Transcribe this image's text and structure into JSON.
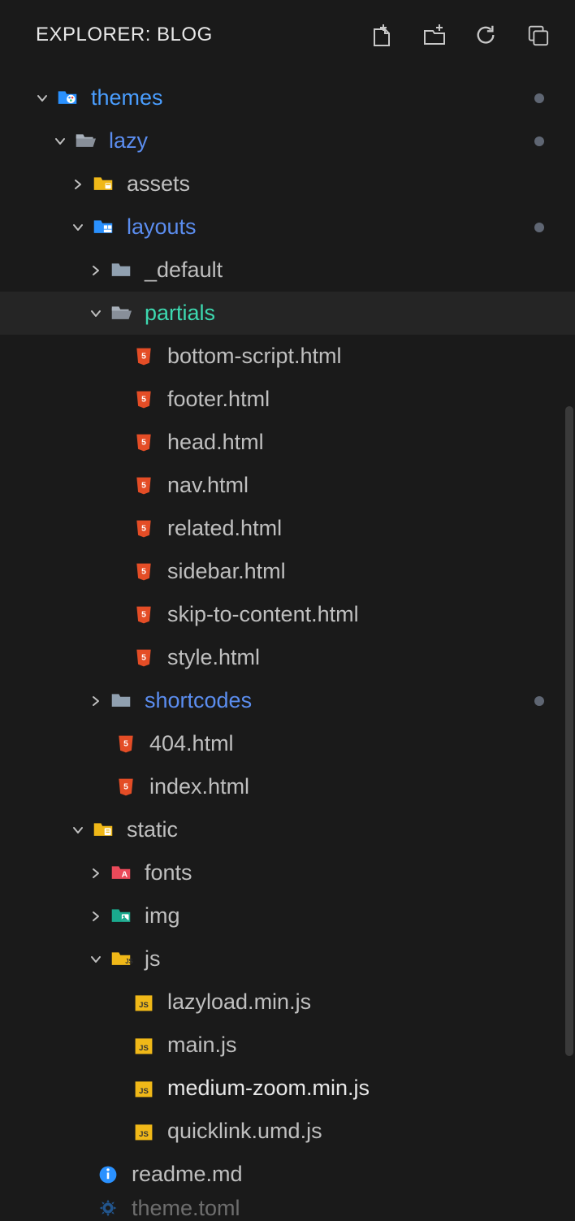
{
  "header": {
    "title": "EXPLORER: BLOG"
  },
  "tree": {
    "themes": {
      "label": "themes"
    },
    "lazy": {
      "label": "lazy"
    },
    "assets": {
      "label": "assets"
    },
    "layouts": {
      "label": "layouts"
    },
    "default": {
      "label": "_default"
    },
    "partials": {
      "label": "partials"
    },
    "bottom_script": {
      "label": "bottom-script.html"
    },
    "footer": {
      "label": "footer.html"
    },
    "head": {
      "label": "head.html"
    },
    "nav": {
      "label": "nav.html"
    },
    "related": {
      "label": "related.html"
    },
    "sidebar": {
      "label": "sidebar.html"
    },
    "skip": {
      "label": "skip-to-content.html"
    },
    "style": {
      "label": "style.html"
    },
    "shortcodes": {
      "label": "shortcodes"
    },
    "404": {
      "label": "404.html"
    },
    "index": {
      "label": "index.html"
    },
    "static": {
      "label": "static"
    },
    "fonts": {
      "label": "fonts"
    },
    "img": {
      "label": "img"
    },
    "js": {
      "label": "js"
    },
    "lazyload": {
      "label": "lazyload.min.js"
    },
    "main": {
      "label": "main.js"
    },
    "medium": {
      "label": "medium-zoom.min.js"
    },
    "quicklink": {
      "label": "quicklink.umd.js"
    },
    "readme": {
      "label": "readme.md"
    },
    "theme_toml": {
      "label": "theme.toml"
    }
  }
}
